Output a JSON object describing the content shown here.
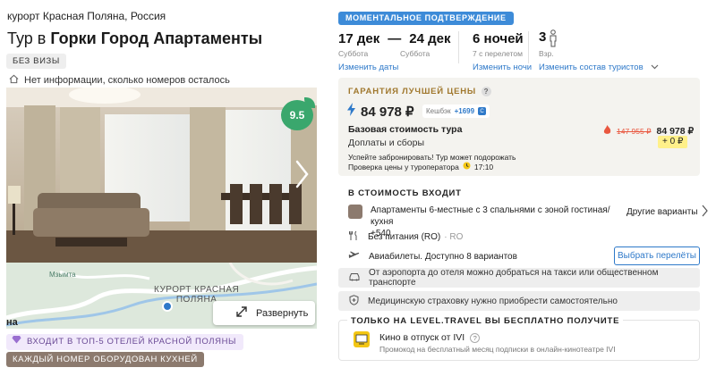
{
  "hotel": {
    "location": "курорт Красная Поляна, Россия",
    "title_prefix": "Тур в",
    "title_name": "Горки Город Апартаменты",
    "visa_badge": "БЕЗ ВИЗЫ",
    "rooms_info": "Нет информации, сколько номеров осталось",
    "rating": "9.5",
    "map_label_line1": "КУРОРТ КРАСНАЯ",
    "map_label_line2": "ПОЛЯНА",
    "map_small_label": "Мзымта",
    "map_edge_label": "на",
    "expand_label": "Развернуть",
    "top5_badge": "ВХОДИТ В ТОП-5 ОТЕЛЕЙ КРАСНОЙ ПОЛЯНЫ",
    "kitchen_badge": "КАЖДЫЙ НОМЕР ОБОРУДОВАН КУХНЕЙ"
  },
  "booking": {
    "instant_badge": "МОМЕНТАЛЬНОЕ ПОДТВЕРЖДЕНИЕ",
    "date_from": "17 дек",
    "date_dash": "—",
    "date_to": "24 дек",
    "day_from": "Суббота",
    "day_to": "Суббота",
    "change_dates": "Изменить даты",
    "nights": "6 ночей",
    "nights_note": "7 с перелетом",
    "change_nights": "Изменить ночи",
    "tourists_count": "3",
    "tourists_note": "Взр.",
    "change_tourists": "Изменить состав туристов"
  },
  "price": {
    "guarantee_title": "ГАРАНТИЯ ЛУЧШЕЙ ЦЕНЫ",
    "guarantee_help": "?",
    "total": "84 978 ₽",
    "cashback_label": "Кешбэк",
    "cashback_value": "+1699",
    "base_label": "Базовая стоимость тура",
    "old_price": "147 955 ₽",
    "base_price": "84 978 ₽",
    "fees_label": "Доплаты и сборы",
    "fees_value": "+ 0 ₽",
    "warning": "Успейте забронировать! Тур может подорожать",
    "check_label": "Проверка цены у туроператора",
    "check_time": "17:10"
  },
  "included": {
    "title": "В СТОИМОСТЬ ВХОДИТ",
    "room": "Апартаменты 6-местные с 3 спальнями с зоной гостиная/кухня",
    "room_extra": "+540",
    "other_variants": "Другие варианты",
    "meal": "Без питания (RO)",
    "meal_code": "· RO",
    "flights": "Авиабилеты. Доступно 8 вариантов",
    "choose_flights": "Выбрать перелёты",
    "transfer": "От аэропорта до отеля можно добраться на такси или общественном транспорте",
    "insurance": "Медицинскую страховку нужно приобрести самостоятельно"
  },
  "promo": {
    "title": "ТОЛЬКО НА LEVEL.TRAVEL ВЫ БЕСПЛАТНО ПОЛУЧИТЕ",
    "item": "Кино в отпуск от IVI",
    "item_note": "Промокод на бесплатный месяц подписки в онлайн-кинотеатре IVI",
    "help": "?"
  },
  "colors": {
    "accent_blue": "#2e79c9",
    "badge_blue": "#3d8bd8",
    "rating_green": "#3aa76d",
    "price_yellow": "#fff08a",
    "purple_badge_bg": "#f1e9fb",
    "brown_badge_bg": "#8c7a6e"
  }
}
